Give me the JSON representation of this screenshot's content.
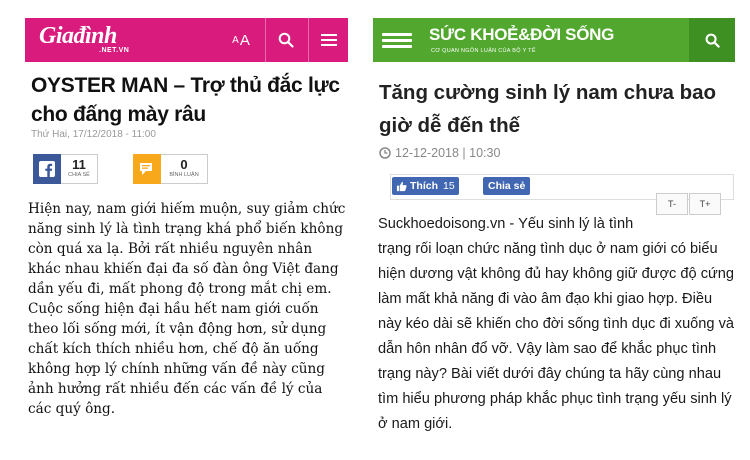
{
  "left": {
    "logo": "Giađình",
    "logo_sub": ".NET.VN",
    "font_toggle_small": "A",
    "font_toggle_big": "A",
    "title": "OYSTER MAN – Trợ thủ đắc lực cho đấng mày râu",
    "date": "Thứ Hai, 17/12/2018 - 11:00",
    "share_count": "11",
    "share_label": "CHIA SẺ",
    "comment_count": "0",
    "comment_label": "BÌNH LUẬN",
    "body": "Hiện nay, nam giới hiếm muộn, suy giảm chức năng sinh lý là tình trạng khá phổ biến không còn quá xa lạ. Bởi rất nhiều nguyên nhân khác nhau khiến đại đa số đàn ông Việt đang dần yếu đi, mất phong độ trong mắt chị em. Cuộc sống hiện đại hầu hết nam giới cuốn theo lối sống mới, ít vận động hơn, sử dụng chất kích thích nhiều hơn, chế độ ăn uống không hợp lý chính những vấn đề này cũng ảnh hưởng rất nhiều đến các vấn đề lý của các quý ông.",
    "colors": {
      "header": "#d81b7c",
      "fb": "#3b5998",
      "comment": "#f7a81b"
    }
  },
  "right": {
    "logo": "SỨC KHOẺ&ĐỜI SỐNG",
    "logo_sub": "CƠ QUAN NGÔN LUẬN CỦA BỘ Y TẾ",
    "title": "Tăng cường sinh lý nam chưa bao giờ dễ đến thế",
    "date": "12-12-2018 | 10:30",
    "like_label": "Thích",
    "like_count": "15",
    "share_label": "Chia sẻ",
    "font_minus": "T-",
    "font_plus": "T+",
    "body_line1": "Suckhoedoisong.vn - Yếu sinh lý là tình",
    "body_rest": "trạng rối loạn chức năng tình dục ở nam giới có biểu hiện dương vật không đủ hay không giữ được độ cứng làm mất khả năng đi vào âm đạo khi giao hợp. Điều này kéo dài sẽ khiến cho đời sống tình dục đi xuống và dẫn hôn nhân đổ vỡ. Vậy làm sao để khắc phục tình trạng này? Bài viết dưới đây chúng ta hãy cùng nhau tìm hiểu phương pháp khắc phục tình trạng yếu sinh lý ở nam giới.",
    "colors": {
      "header": "#52a82e",
      "like": "#4267b2"
    }
  },
  "icons": [
    "search-icon",
    "menu-icon",
    "facebook-icon",
    "comment-icon",
    "clock-icon",
    "thumbs-up-icon"
  ]
}
